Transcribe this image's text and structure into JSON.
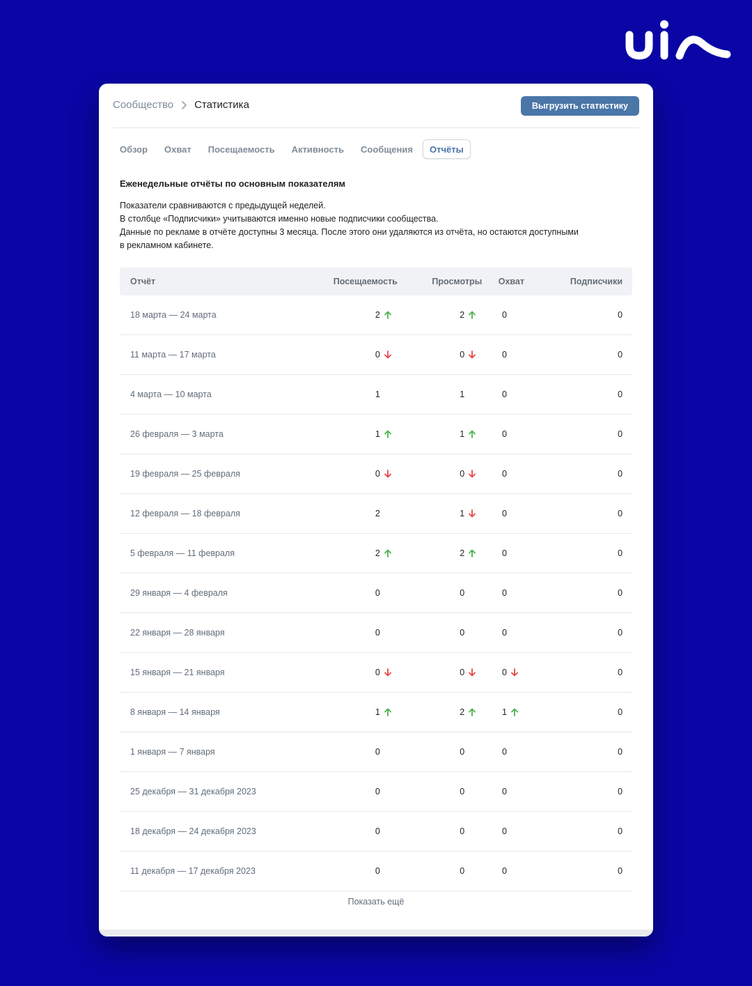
{
  "breadcrumb": {
    "root": "Сообщество",
    "current": "Статистика"
  },
  "export_button": "Выгрузить статистику",
  "tabs": [
    "Обзор",
    "Охват",
    "Посещаемость",
    "Активность",
    "Сообщения",
    "Отчёты"
  ],
  "active_tab": 5,
  "section_title": "Еженедельные отчёты по основным показателям",
  "description": [
    "Показатели сравниваются с предыдущей неделей.",
    "В столбце «Подписчики» учитываются именно новые подписчики сообщества.",
    "Данные по рекламе в отчёте доступны 3 месяца. После этого они удаляются из отчёта, но остаются доступными",
    "в рекламном кабинете."
  ],
  "table": {
    "headers": [
      "Отчёт",
      "Посещаемость",
      "Просмотры",
      "Охват",
      "Подписчики"
    ],
    "rows": [
      {
        "name": "18 марта — 24 марта",
        "visits": "2",
        "visits_trend": "up",
        "views": "2",
        "views_trend": "up",
        "reach": "0",
        "reach_trend": "",
        "subs": "0"
      },
      {
        "name": "11 марта — 17 марта",
        "visits": "0",
        "visits_trend": "down",
        "views": "0",
        "views_trend": "down",
        "reach": "0",
        "reach_trend": "",
        "subs": "0"
      },
      {
        "name": "4 марта — 10 марта",
        "visits": "1",
        "visits_trend": "",
        "views": "1",
        "views_trend": "",
        "reach": "0",
        "reach_trend": "",
        "subs": "0"
      },
      {
        "name": "26 февраля — 3 марта",
        "visits": "1",
        "visits_trend": "up",
        "views": "1",
        "views_trend": "up",
        "reach": "0",
        "reach_trend": "",
        "subs": "0"
      },
      {
        "name": "19 февраля — 25 февраля",
        "visits": "0",
        "visits_trend": "down",
        "views": "0",
        "views_trend": "down",
        "reach": "0",
        "reach_trend": "",
        "subs": "0"
      },
      {
        "name": "12 февраля — 18 февраля",
        "visits": "2",
        "visits_trend": "",
        "views": "1",
        "views_trend": "down",
        "reach": "0",
        "reach_trend": "",
        "subs": "0"
      },
      {
        "name": "5 февраля — 11 февраля",
        "visits": "2",
        "visits_trend": "up",
        "views": "2",
        "views_trend": "up",
        "reach": "0",
        "reach_trend": "",
        "subs": "0"
      },
      {
        "name": "29 января — 4 февраля",
        "visits": "0",
        "visits_trend": "",
        "views": "0",
        "views_trend": "",
        "reach": "0",
        "reach_trend": "",
        "subs": "0"
      },
      {
        "name": "22 января — 28 января",
        "visits": "0",
        "visits_trend": "",
        "views": "0",
        "views_trend": "",
        "reach": "0",
        "reach_trend": "",
        "subs": "0"
      },
      {
        "name": "15 января — 21 января",
        "visits": "0",
        "visits_trend": "down",
        "views": "0",
        "views_trend": "down",
        "reach": "0",
        "reach_trend": "down",
        "subs": "0"
      },
      {
        "name": "8 января — 14 января",
        "visits": "1",
        "visits_trend": "up",
        "views": "2",
        "views_trend": "up",
        "reach": "1",
        "reach_trend": "up",
        "subs": "0"
      },
      {
        "name": "1 января — 7 января",
        "visits": "0",
        "visits_trend": "",
        "views": "0",
        "views_trend": "",
        "reach": "0",
        "reach_trend": "",
        "subs": "0"
      },
      {
        "name": "25 декабря — 31 декабря 2023",
        "visits": "0",
        "visits_trend": "",
        "views": "0",
        "views_trend": "",
        "reach": "0",
        "reach_trend": "",
        "subs": "0"
      },
      {
        "name": "18 декабря — 24 декабря 2023",
        "visits": "0",
        "visits_trend": "",
        "views": "0",
        "views_trend": "",
        "reach": "0",
        "reach_trend": "",
        "subs": "0"
      },
      {
        "name": "11 декабря — 17 декабря 2023",
        "visits": "0",
        "visits_trend": "",
        "views": "0",
        "views_trend": "",
        "reach": "0",
        "reach_trend": "",
        "subs": "0"
      }
    ]
  },
  "show_more": "Показать ещё",
  "colors": {
    "background": "#0a06a6",
    "accent": "#4a76a8",
    "up": "#4bb34b",
    "down": "#e64646"
  },
  "icons": {
    "logo": "brand-logo-icon",
    "breadcrumb_separator": "chevron-right-icon",
    "up": "arrow-up-icon",
    "down": "arrow-down-icon"
  }
}
